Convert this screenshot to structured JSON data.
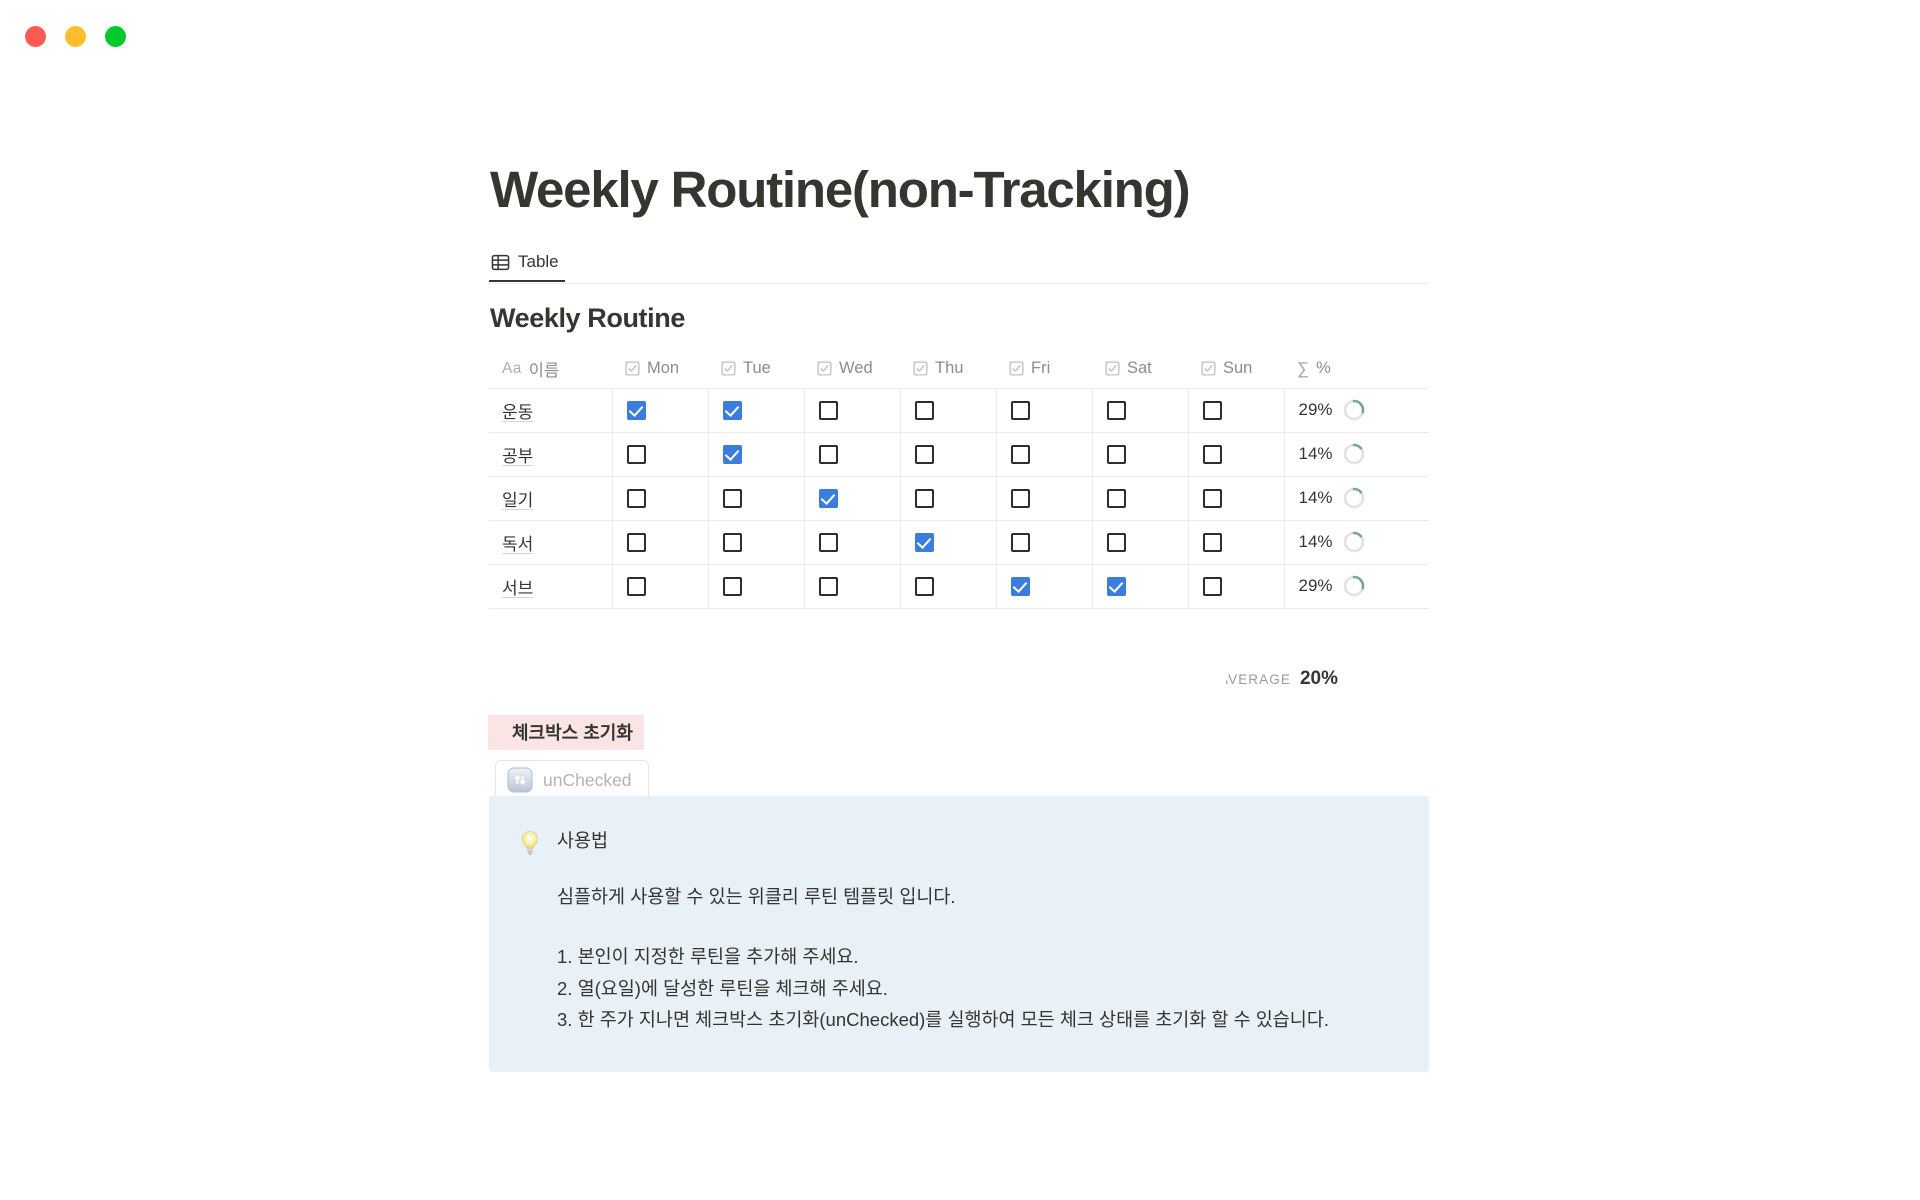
{
  "window": {
    "traffic_lights": [
      {
        "name": "close-button",
        "color": "#ff5a52"
      },
      {
        "name": "minimize-button",
        "color": "#ffbd2e"
      },
      {
        "name": "maximize-button",
        "color": "#00ca2c"
      }
    ]
  },
  "page": {
    "title": "Weekly Routine(non-Tracking)"
  },
  "views": {
    "tabs": [
      {
        "label": "Table",
        "icon": "table-grid-icon",
        "active": true
      }
    ]
  },
  "database": {
    "title": "Weekly Routine",
    "columns": [
      {
        "key": "name",
        "label": "이름",
        "icon": "aa-text-icon"
      },
      {
        "key": "mon",
        "label": "Mon",
        "icon": "checkbox-icon"
      },
      {
        "key": "tue",
        "label": "Tue",
        "icon": "checkbox-icon"
      },
      {
        "key": "wed",
        "label": "Wed",
        "icon": "checkbox-icon"
      },
      {
        "key": "thu",
        "label": "Thu",
        "icon": "checkbox-icon"
      },
      {
        "key": "fri",
        "label": "Fri",
        "icon": "checkbox-icon"
      },
      {
        "key": "sat",
        "label": "Sat",
        "icon": "checkbox-icon"
      },
      {
        "key": "sun",
        "label": "Sun",
        "icon": "checkbox-icon"
      },
      {
        "key": "pct",
        "label": "%",
        "icon": "sigma-icon"
      }
    ],
    "rows": [
      {
        "name": "운동",
        "checks": [
          true,
          true,
          false,
          false,
          false,
          false,
          false
        ],
        "percent": "29%",
        "percent_value": 29
      },
      {
        "name": "공부",
        "checks": [
          false,
          true,
          false,
          false,
          false,
          false,
          false
        ],
        "percent": "14%",
        "percent_value": 14
      },
      {
        "name": "일기",
        "checks": [
          false,
          false,
          true,
          false,
          false,
          false,
          false
        ],
        "percent": "14%",
        "percent_value": 14
      },
      {
        "name": "독서",
        "checks": [
          false,
          false,
          false,
          true,
          false,
          false,
          false
        ],
        "percent": "14%",
        "percent_value": 14
      },
      {
        "name": "서브",
        "checks": [
          false,
          false,
          false,
          false,
          true,
          true,
          false
        ],
        "percent": "29%",
        "percent_value": 29
      }
    ],
    "footer": {
      "label": "AVERAGE",
      "value": "20%"
    },
    "colors": {
      "checkbox_checked": "#3b7ddd",
      "ring_progress": "#7ba88a",
      "ring_track": "#e3e2df"
    }
  },
  "reset_section": {
    "heading": "체크박스 초기화",
    "heading_highlight": "#fae4e4",
    "button": {
      "label": "unChecked",
      "icon": "sync-arrows-icon"
    }
  },
  "callout": {
    "icon": "lightbulb-icon",
    "background": "#e8f0f8",
    "title": "사용법",
    "lead": "심플하게 사용할 수 있는 위클리 루틴 템플릿 입니다.",
    "items": [
      "1. 본인이 지정한 루틴을 추가해 주세요.",
      "2. 열(요일)에 달성한 루틴을 체크해 주세요.",
      "3. 한 주가 지나면 체크박스 초기화(unChecked)를 실행하여 모든 체크 상태를 초기화 할 수 있습니다."
    ]
  }
}
